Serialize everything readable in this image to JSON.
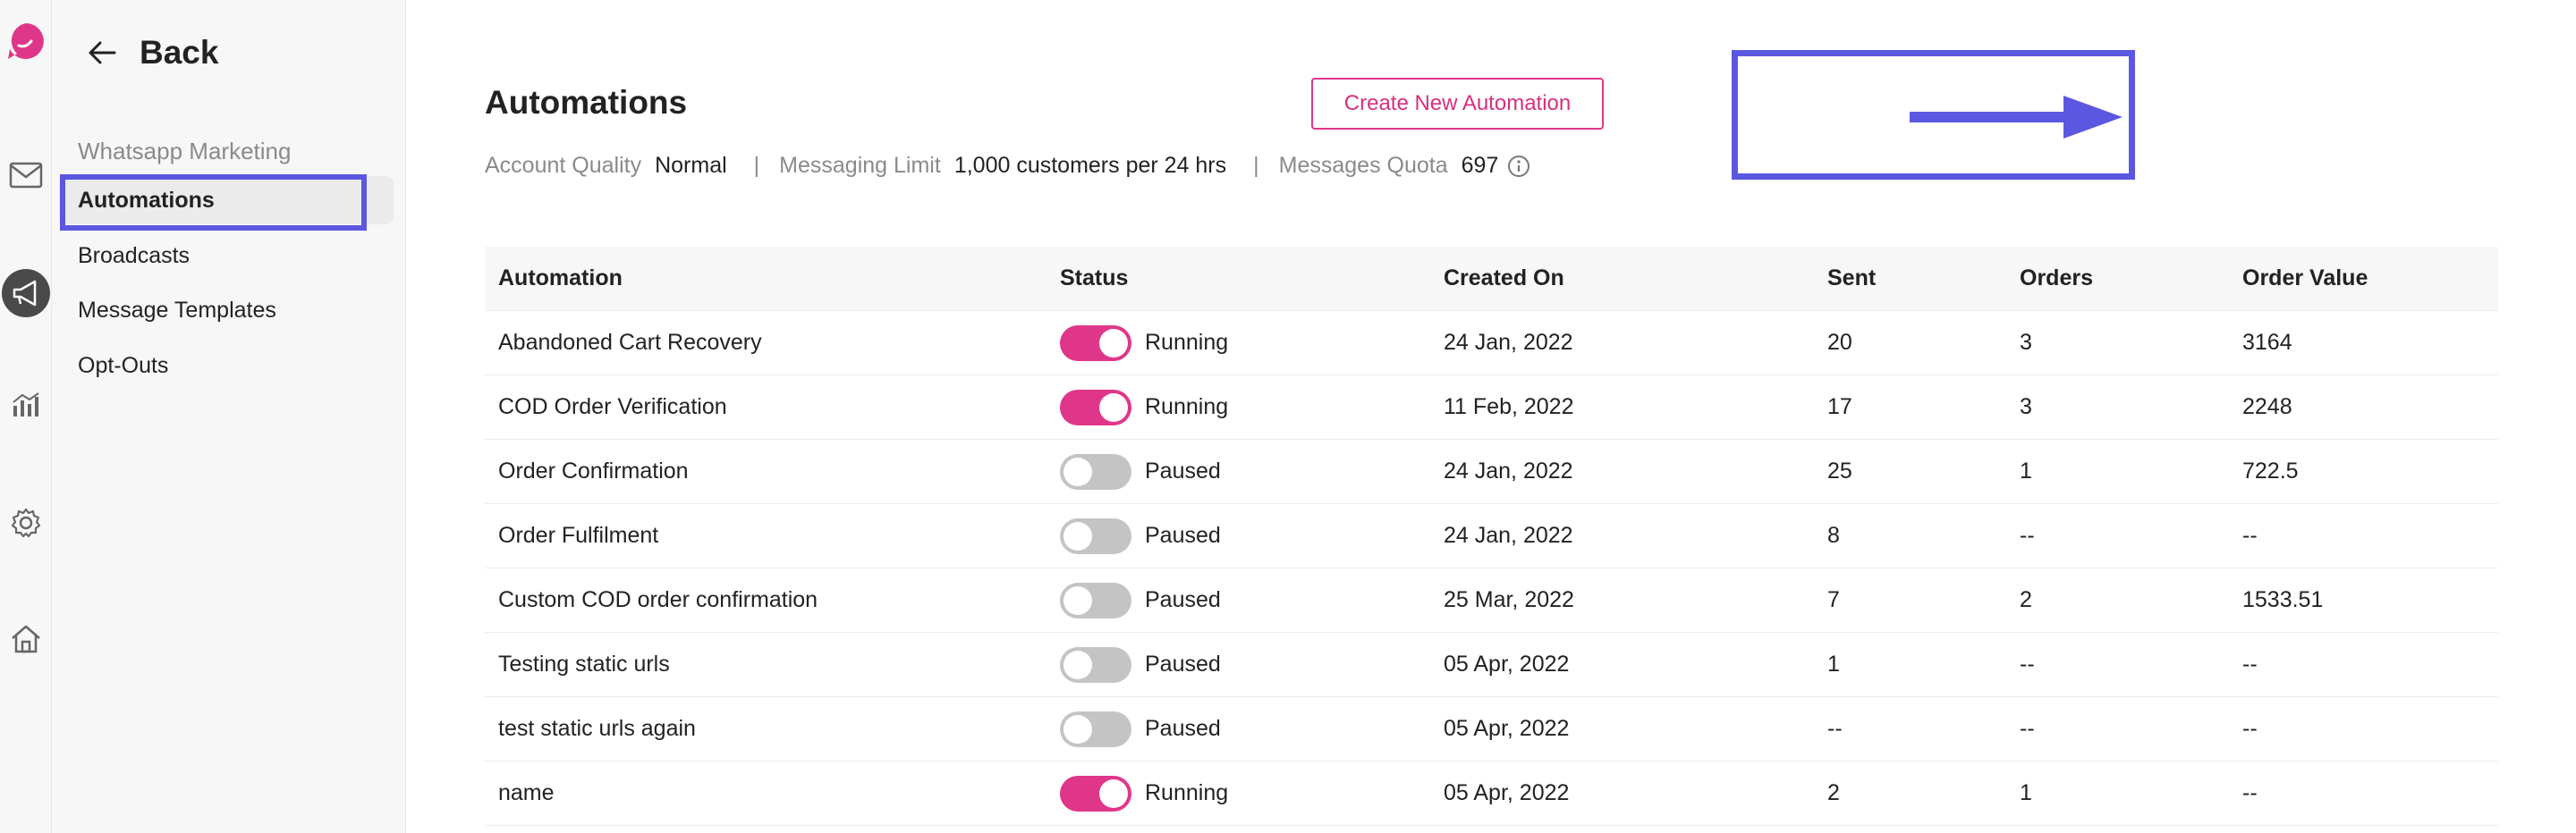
{
  "colors": {
    "accent": "#e0368a",
    "highlight": "#5b57e0",
    "muted": "#8a8a8a"
  },
  "rail": {
    "icons": [
      "brand-logo-icon",
      "mail-icon",
      "megaphone-icon",
      "analytics-icon",
      "gear-icon",
      "home-icon"
    ]
  },
  "sidebar": {
    "back_label": "Back",
    "section_title": "Whatsapp Marketing",
    "items": [
      {
        "label": "Automations",
        "active": true
      },
      {
        "label": "Broadcasts",
        "active": false
      },
      {
        "label": "Message Templates",
        "active": false
      },
      {
        "label": "Opt-Outs",
        "active": false
      }
    ]
  },
  "main": {
    "title": "Automations",
    "account_quality_label": "Account Quality",
    "account_quality_value": "Normal",
    "messaging_limit_label": "Messaging Limit",
    "messaging_limit_value": "1,000 customers per 24 hrs",
    "separator": "|",
    "messages_quota_label": "Messages Quota",
    "messages_quota_value": "697",
    "create_button_label": "Create New Automation"
  },
  "table": {
    "columns": [
      "Automation",
      "Status",
      "Created On",
      "Sent",
      "Orders",
      "Order Value"
    ],
    "rows": [
      {
        "name": "Abandoned Cart Recovery",
        "running": true,
        "status": "Running",
        "created": "24 Jan, 2022",
        "sent": "20",
        "orders": "3",
        "value": "3164"
      },
      {
        "name": "COD Order Verification",
        "running": true,
        "status": "Running",
        "created": "11 Feb, 2022",
        "sent": "17",
        "orders": "3",
        "value": "2248"
      },
      {
        "name": "Order Confirmation",
        "running": false,
        "status": "Paused",
        "created": "24 Jan, 2022",
        "sent": "25",
        "orders": "1",
        "value": "722.5"
      },
      {
        "name": "Order Fulfilment",
        "running": false,
        "status": "Paused",
        "created": "24 Jan, 2022",
        "sent": "8",
        "orders": "--",
        "value": "--"
      },
      {
        "name": "Custom COD order confirmation",
        "running": false,
        "status": "Paused",
        "created": "25 Mar, 2022",
        "sent": "7",
        "orders": "2",
        "value": "1533.51"
      },
      {
        "name": "Testing static urls",
        "running": false,
        "status": "Paused",
        "created": "05 Apr, 2022",
        "sent": "1",
        "orders": "--",
        "value": "--"
      },
      {
        "name": "test static urls again",
        "running": false,
        "status": "Paused",
        "created": "05 Apr, 2022",
        "sent": "--",
        "orders": "--",
        "value": "--"
      },
      {
        "name": "name",
        "running": true,
        "status": "Running",
        "created": "05 Apr, 2022",
        "sent": "2",
        "orders": "1",
        "value": "--"
      }
    ]
  }
}
